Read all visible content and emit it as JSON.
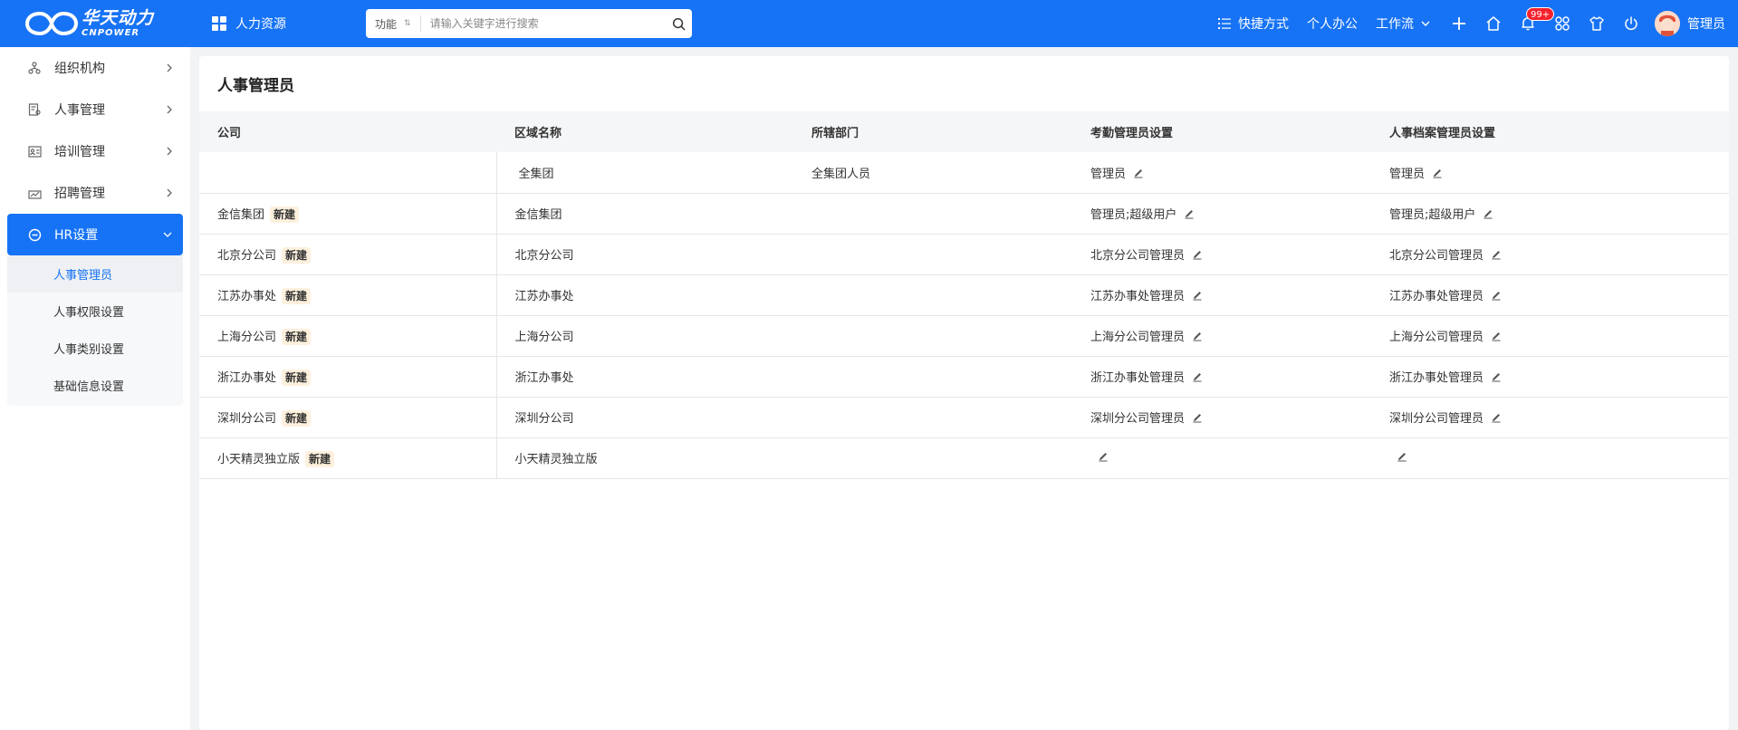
{
  "brand": {
    "name_cn": "华天动力",
    "name_en": "CNPOWER"
  },
  "module": {
    "label": "人力资源"
  },
  "search": {
    "scope": "功能",
    "placeholder": "请输入关键字进行搜索"
  },
  "top_nav": {
    "shortcut": "快捷方式",
    "personal": "个人办公",
    "workflow": "工作流",
    "notify_badge": "99+",
    "user": "管理员"
  },
  "sidebar": {
    "items": [
      {
        "label": "组织机构"
      },
      {
        "label": "人事管理"
      },
      {
        "label": "培训管理"
      },
      {
        "label": "招聘管理"
      },
      {
        "label": "HR设置"
      }
    ],
    "sub_items": [
      {
        "label": "人事管理员"
      },
      {
        "label": "人事权限设置"
      },
      {
        "label": "人事类别设置"
      },
      {
        "label": "基础信息设置"
      }
    ]
  },
  "page": {
    "title": "人事管理员"
  },
  "table": {
    "headers": [
      "公司",
      "区域名称",
      "所辖部门",
      "考勤管理员设置",
      "人事档案管理员设置"
    ],
    "tag_label": "新建",
    "rows": [
      {
        "company": "",
        "region": "全集团",
        "dept": "全集团人员",
        "attendance": "管理员",
        "archive": "管理员"
      },
      {
        "company": "金信集团",
        "region": "金信集团",
        "dept": "",
        "attendance": "管理员;超级用户",
        "archive": "管理员;超级用户"
      },
      {
        "company": "北京分公司",
        "region": "北京分公司",
        "dept": "",
        "attendance": "北京分公司管理员",
        "archive": "北京分公司管理员"
      },
      {
        "company": "江苏办事处",
        "region": "江苏办事处",
        "dept": "",
        "attendance": "江苏办事处管理员",
        "archive": "江苏办事处管理员"
      },
      {
        "company": "上海分公司",
        "region": "上海分公司",
        "dept": "",
        "attendance": "上海分公司管理员",
        "archive": "上海分公司管理员"
      },
      {
        "company": "浙江办事处",
        "region": "浙江办事处",
        "dept": "",
        "attendance": "浙江办事处管理员",
        "archive": "浙江办事处管理员"
      },
      {
        "company": "深圳分公司",
        "region": "深圳分公司",
        "dept": "",
        "attendance": "深圳分公司管理员",
        "archive": "深圳分公司管理员"
      },
      {
        "company": "小天精灵独立版",
        "region": "小天精灵独立版",
        "dept": "",
        "attendance": "",
        "archive": ""
      }
    ]
  },
  "colors": {
    "primary": "#1773f5",
    "badge": "#f5222d",
    "tag_bg": "#fdf0dd"
  }
}
